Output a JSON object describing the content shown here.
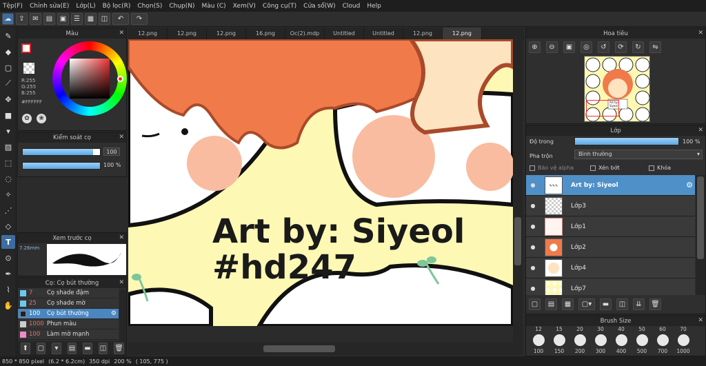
{
  "menu": [
    "Tệp(F)",
    "Chỉnh sửa(E)",
    "Lớp(L)",
    "Bộ lọc(R)",
    "Chọn(S)",
    "Chụp(N)",
    "Màu (C)",
    "Xem(V)",
    "Công cụ(T)",
    "Cửa sổ(W)",
    "Cloud",
    "Help"
  ],
  "color_panel": {
    "title": "Màu",
    "r": "R:255",
    "g": "G:255",
    "b": "B:255",
    "hex": "#FFFFFF"
  },
  "brush_control": {
    "title": "Kiểm soát cọ",
    "size": "100",
    "opacity": "100 %"
  },
  "brush_preview": {
    "title": "Xem trước cọ",
    "size": "7.26mm"
  },
  "brush_list": {
    "title": "Cọ: Cọ bút thường",
    "items": [
      {
        "value": "7",
        "name": "Cọ shade đậm",
        "color": "#6cc8f0"
      },
      {
        "value": "25",
        "name": "Cọ shade mờ",
        "color": "#6cc8f0"
      },
      {
        "value": "100",
        "name": "Cọ bút thường",
        "color": "#222222",
        "selected": true
      },
      {
        "value": "1000",
        "name": "Phun màu",
        "color": "#cccccc"
      },
      {
        "value": "100",
        "name": "Làm mờ mạnh",
        "color": "#f08ac8"
      }
    ]
  },
  "tabs": [
    "12.png",
    "12.png",
    "12.png",
    "16.png",
    "Oc(2).mdp",
    "Untitled",
    "Untitled",
    "12.png",
    "12.png"
  ],
  "canvas": {
    "line1": "Art by: Siyeol",
    "line2": "#hd247"
  },
  "navigator": {
    "title": "Hoa tiêu",
    "thumb_text": "Art by: Siyeol"
  },
  "layer_panel": {
    "title": "Lớp",
    "opacity_label": "Độ trong",
    "opacity_value": "100 %",
    "blend_label": "Pha trộn",
    "blend_value": "Bình thường",
    "protect_alpha": "Bảo vệ alpha",
    "clipping": "Xén bớt",
    "lock": "Khóa",
    "layers": [
      {
        "name": "Art by: Siyeol",
        "selected": true
      },
      {
        "name": "Lớp3"
      },
      {
        "name": "Lớp1"
      },
      {
        "name": "Lớp2"
      },
      {
        "name": "Lớp4"
      },
      {
        "name": "Lớp7"
      }
    ]
  },
  "brush_size": {
    "title": "Brush Size",
    "top_sizes": [
      "12",
      "15",
      "20",
      "30",
      "40",
      "50",
      "60",
      "70"
    ],
    "sizes": [
      "100",
      "150",
      "200",
      "300",
      "400",
      "500",
      "700",
      "1000"
    ]
  },
  "status": {
    "dims": "850 * 850 pixel",
    "cm": "(6.2 * 6.2cm)",
    "dpi": "350 dpi",
    "zoom": "200 %",
    "coords": "( 105, 775 )"
  },
  "colors": {
    "accent": "#4a86c0",
    "panel": "#2f2f2f",
    "canvas_bg": "#fdf8b4",
    "hair": "#f07a4a"
  }
}
